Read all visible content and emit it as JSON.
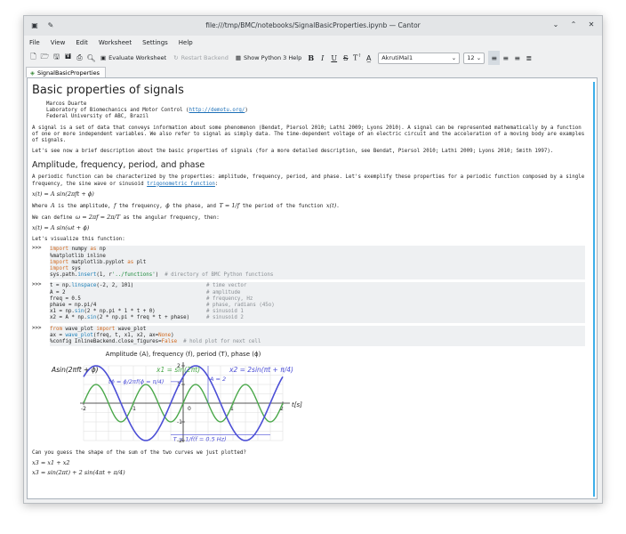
{
  "window": {
    "title": "file:///tmp/BMC/notebooks/SignalBasicProperties.ipynb — Cantor"
  },
  "menu": [
    "File",
    "View",
    "Edit",
    "Worksheet",
    "Settings",
    "Help"
  ],
  "toolbar": {
    "evaluate": "Evaluate Worksheet",
    "restart": "Restart Backend",
    "show_help": "Show Python 3 Help",
    "bold": "B",
    "italic": "I",
    "underline": "U",
    "strike": "S",
    "superscript": "T",
    "font": "AkrutiMal1",
    "size": "12"
  },
  "tab": {
    "label": "SignalBasicProperties"
  },
  "doc": {
    "title": "Basic properties of signals",
    "author": [
      "Marcos Duarte",
      "Laboratory of Biomechanics and Motor Control (",
      "http://demotu.org/",
      ")",
      "Federal University of ABC, Brazil"
    ],
    "p1": "A signal is a set of data that conveys information about some phenomenon (Bendat, Piersol 2010; Lathi 2009; Lyons 2010). A signal can be represented mathematically by a function of one or more independent variables. We also refer to signal as simply data. The time-dependent voltage of an electric circuit and the acceleration of a moving body are examples of signals.",
    "p2": "Let's see now a brief description about the basic properties of signals (for a more detailed description, see Bendat, Piersol 2010; Lathi 2009; Lyons 2010; Smith 1997).",
    "h2": "Amplitude, frequency, period, and phase",
    "p3a": "A periodic function can be characterized by the properties: amplitude, frequency, period, and phase. Let's exemplify these properties for a periodic function composed by a single frequency, the sine wave or sinusoid ",
    "p3link": "trigonometric function",
    "p3b": ":",
    "eq1": "x(t) = A sin(2πft + ϕ)",
    "p4": [
      "Where ",
      "A",
      " is the amplitude, ",
      "f",
      " the frequency, ",
      "ϕ",
      " the phase, and ",
      "T = 1/f",
      " the period of the function ",
      "x(t)",
      "."
    ],
    "p5": [
      "We can define ",
      "ω = 2πf = 2π/T",
      " as the angular frequency, then:"
    ],
    "eq2": "x(t) = A sin(ωt + ϕ)",
    "p6": "Let's visualize this function:",
    "prompt": ">>>",
    "cell1": [
      [
        [
          "kw",
          "import"
        ],
        [
          "t",
          " numpy "
        ],
        [
          "kw",
          "as"
        ],
        [
          "t",
          " np"
        ]
      ],
      [
        [
          "t",
          "%matplotlib inline"
        ]
      ],
      [
        [
          "kw",
          "import"
        ],
        [
          "t",
          " matplotlib.pyplot "
        ],
        [
          "kw",
          "as"
        ],
        [
          "t",
          " plt"
        ]
      ],
      [
        [
          "kw",
          "import"
        ],
        [
          "t",
          " sys"
        ]
      ],
      [
        [
          "t",
          "sys.path."
        ],
        [
          "fn",
          "insert"
        ],
        [
          "t",
          "(1, r"
        ],
        [
          "str",
          "'../functions'"
        ],
        [
          "t",
          ")  "
        ],
        [
          "cmt",
          "# directory of BMC Python functions"
        ]
      ]
    ],
    "cell2": [
      {
        "code": [
          [
            "t",
            "t = np."
          ],
          [
            "fn",
            "linspace"
          ],
          [
            "t",
            "(-2, 2, 101)"
          ]
        ],
        "comment": "# time vector"
      },
      {
        "code": [
          [
            "t",
            "A = 2"
          ]
        ],
        "comment": "# amplitude"
      },
      {
        "code": [
          [
            "t",
            "freq = 0.5"
          ]
        ],
        "comment": "# frequency, Hz"
      },
      {
        "code": [
          [
            "t",
            "phase = np.pi/4"
          ]
        ],
        "comment": "# phase, radians (45o)"
      },
      {
        "code": [
          [
            "t",
            "x1 = np."
          ],
          [
            "fn",
            "sin"
          ],
          [
            "t",
            "(2 * np.pi * 1 * t + 0)"
          ]
        ],
        "comment": "# sinusoid 1"
      },
      {
        "code": [
          [
            "t",
            "x2 = A * np."
          ],
          [
            "fn",
            "sin"
          ],
          [
            "t",
            "(2 * np.pi * freq * t + phase)"
          ]
        ],
        "comment": "# sinusoid 2"
      }
    ],
    "cell3": [
      [
        [
          "kw",
          "from"
        ],
        [
          "t",
          " wave_plot "
        ],
        [
          "kw",
          "import"
        ],
        [
          "t",
          " wave_plot"
        ]
      ],
      [
        [
          "t",
          "ax = "
        ],
        [
          "fn",
          "wave_plot"
        ],
        [
          "t",
          "(freq, t, x1, x2, ax="
        ],
        [
          "kw",
          "None"
        ],
        [
          "t",
          ")"
        ]
      ],
      [
        [
          "t",
          "%config InlineBackend.close_figures="
        ],
        [
          "kw",
          "False"
        ],
        [
          "t",
          "  "
        ],
        [
          "cmt",
          "# hold plot for next cell"
        ]
      ]
    ],
    "p7": "Can you guess the shape of the sum of the two curves we just plotted?",
    "eq3": "x3 = x1 + x2",
    "eq4": "x3 = sin(2πt) + 2 sin(4πt + π/4)"
  },
  "chart_data": {
    "type": "line",
    "title": "Amplitude (A), frequency (f), period (T), phase (ϕ)",
    "xlabel": "t[s]",
    "xlim": [
      -2,
      2
    ],
    "ylim": [
      -2,
      2
    ],
    "x_ticks": [
      -2,
      -1,
      0,
      1,
      2
    ],
    "y_ticks": [
      -2,
      -1,
      1,
      2
    ],
    "grid": true,
    "series": [
      {
        "name": "Asin(2πft + ϕ)",
        "color": "#4c4fd6",
        "amplitude": 2,
        "frequency": 0.5,
        "phase": 0.7854
      },
      {
        "name": "x1 = sin(2πt)",
        "color": "#4aa84a",
        "amplitude": 1,
        "frequency": 1,
        "phase": 0
      },
      {
        "name": "x2 = 2sin(πt + π/4)",
        "color": "#4c4fd6",
        "amplitude": 2,
        "frequency": 0.5,
        "phase": 0.7854
      }
    ],
    "annotations": {
      "phase_label": "tϕ = ϕ/2πf(ϕ = π/4)",
      "amp_label": "A = 2",
      "period_label": "T = 1/f(f = 0.5 Hz)"
    }
  }
}
